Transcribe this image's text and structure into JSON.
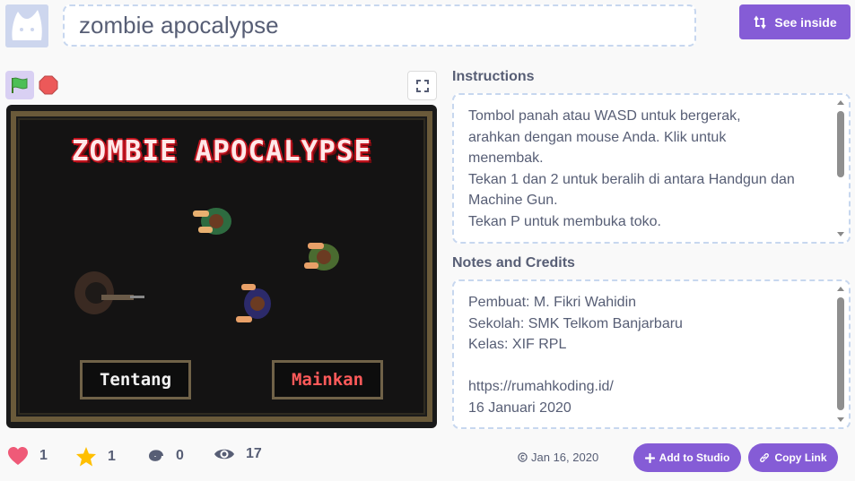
{
  "project": {
    "title": "zombie apocalypse",
    "see_inside_label": "See inside"
  },
  "game": {
    "title": "ZOMBIE APOCALYPSE",
    "about_button": "Tentang",
    "play_button": "Mainkan"
  },
  "instructions": {
    "heading": "Instructions",
    "text": "Tombol panah atau WASD untuk bergerak, arahkan dengan mouse Anda. Klik untuk menembak.\nTekan 1 dan 2 untuk beralih di antara Handgun dan Machine Gun.\nTekan P untuk membuka toko.\n-------------------------------------------------------------------\nArrow keys or WASD to move, aim with your mouse",
    "scroll_position": 0.0
  },
  "notes": {
    "heading": "Notes and Credits",
    "text": "Pembuat: M. Fikri Wahidin\nSekolah: SMK Telkom Banjarbaru\nKelas: XIF RPL\n\nhttps://rumahkoding.id/\n16 Januari 2020",
    "scroll_position": 0.0
  },
  "stats": {
    "loves": "1",
    "favorites": "1",
    "remixes": "0",
    "views": "17"
  },
  "footer": {
    "date": "Jan 16, 2020",
    "add_to_studio_label": "Add to Studio",
    "copy_link_label": "Copy Link"
  },
  "icons": {
    "flag": "green-flag-icon",
    "stop": "stop-icon",
    "fullscreen": "fullscreen-icon",
    "see_inside": "remix-arrows-icon",
    "love": "heart-icon",
    "favorite": "star-icon",
    "remix": "spiral-icon",
    "views": "eye-icon",
    "date": "copyright-icon",
    "add": "plus-icon",
    "link": "link-icon"
  },
  "colors": {
    "accent": "#855cd6",
    "heart": "#ef5a78",
    "star": "#ffbf00",
    "title_red": "#c3141f"
  }
}
